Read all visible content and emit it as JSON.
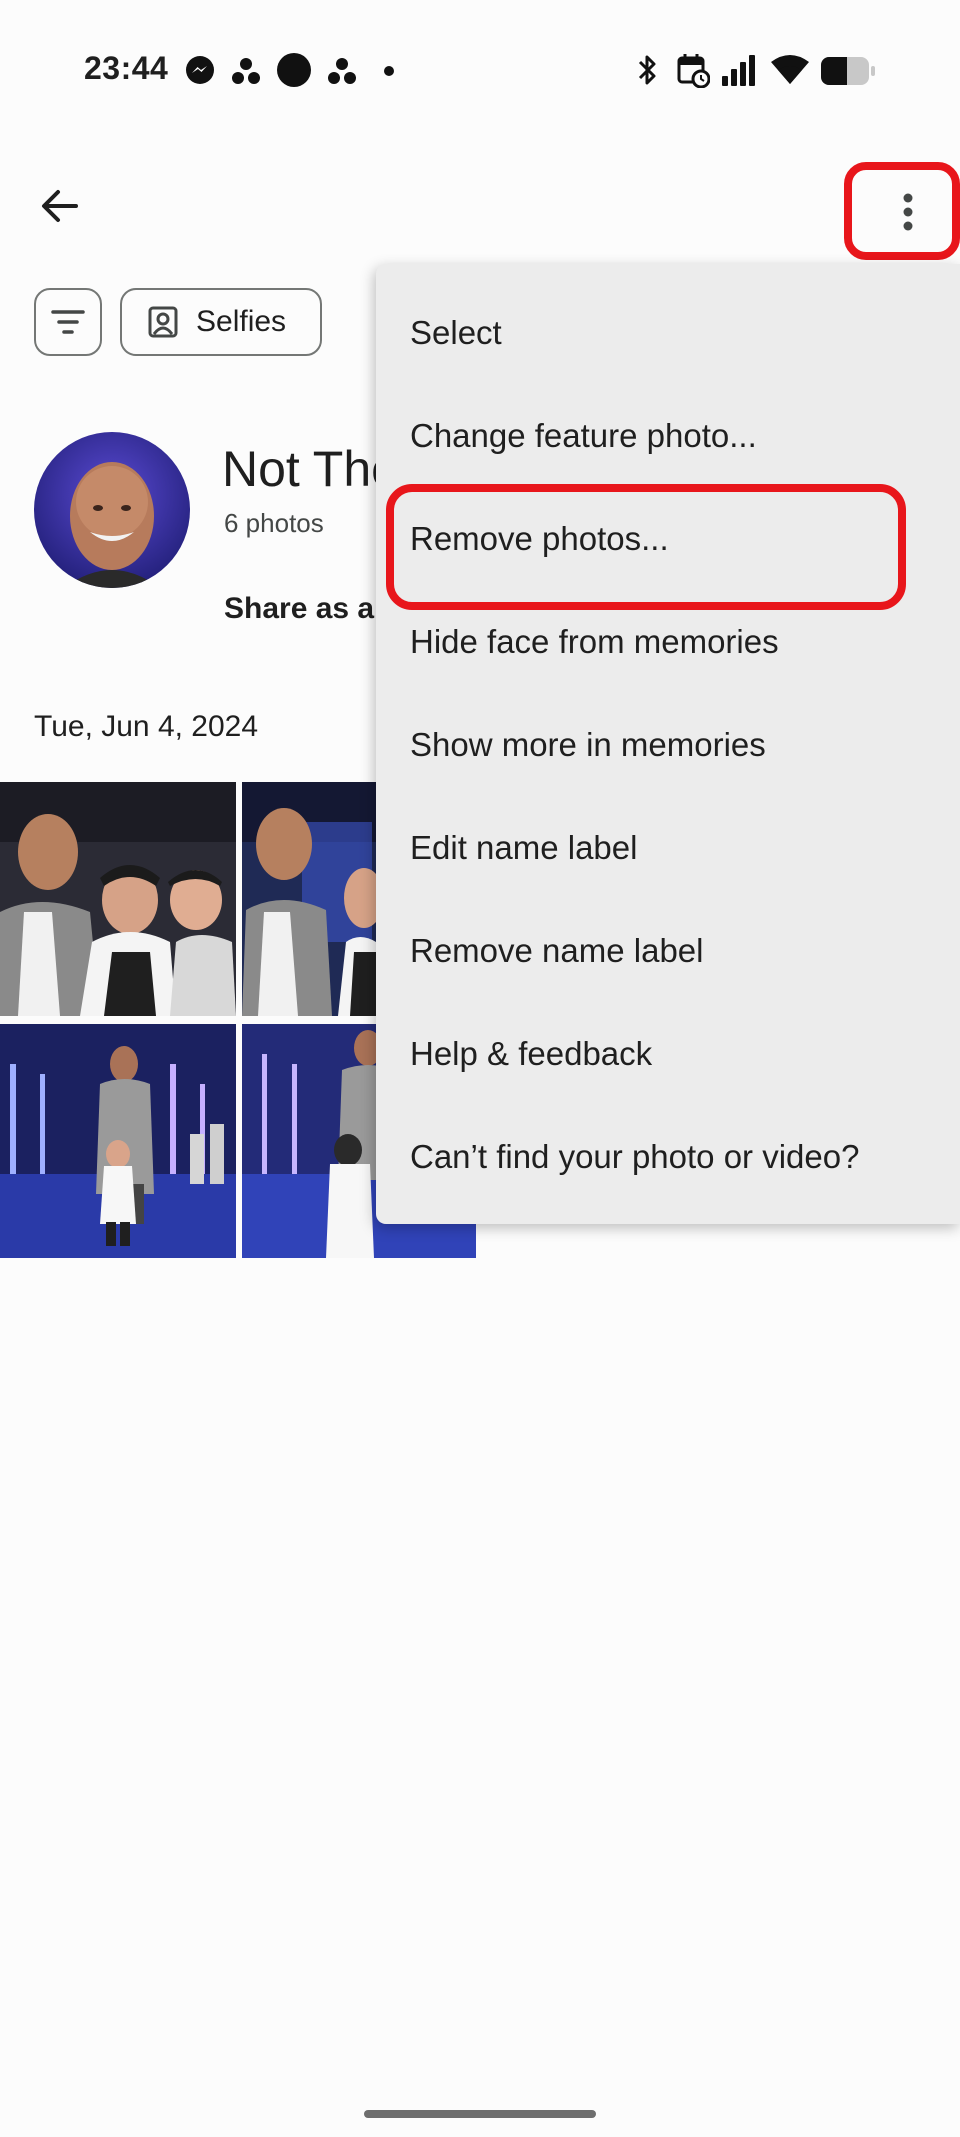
{
  "status_bar": {
    "time": "23:44"
  },
  "header": {
    "back_icon": "arrow-left-icon",
    "more_icon": "more-vertical-icon"
  },
  "chips": {
    "filter_icon": "filter-icon",
    "selfies_label": "Selfies"
  },
  "person": {
    "name": "Not The",
    "photo_count": "6 photos",
    "share_label": "Share as all"
  },
  "date_label": "Tue, Jun 4, 2024",
  "menu": {
    "items": [
      "Select",
      "Change feature photo...",
      "Remove photos...",
      "Hide face from memories",
      "Show more in memories",
      "Edit name label",
      "Remove name label",
      "Help & feedback",
      "Can’t find your photo or video?"
    ]
  },
  "colors": {
    "highlight": "#e8161b",
    "menu_bg": "#ececec",
    "page_bg": "#fcfcfc"
  }
}
